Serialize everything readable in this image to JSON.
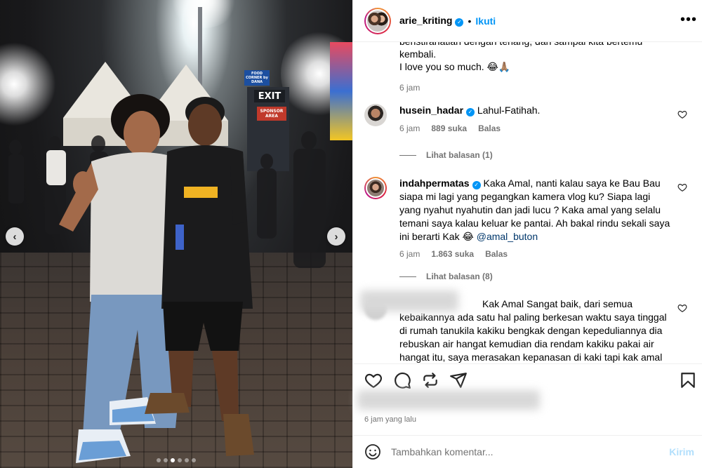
{
  "photo": {
    "signs": {
      "exit": "EXIT",
      "food_corner": "FOOD CORNER by DANA",
      "sponsor": "SPONSOR AREA"
    },
    "carousel": {
      "total_slides": 6,
      "active_index": 2
    }
  },
  "header": {
    "username": "arie_kriting",
    "follow_label": "Ikuti",
    "more_label": "•••",
    "separator": "•"
  },
  "caption": {
    "lines": [
      "beristirahatlah dengan tenang, dan sampai kita bertemu",
      "kembali.",
      "I love you so much. 😂🙏🏽"
    ],
    "time": "6 jam"
  },
  "comments": [
    {
      "username": "husein_hadar",
      "text": "Lahul-Fatihah.",
      "time": "6 jam",
      "likes": "889 suka",
      "reply_label": "Balas",
      "view_replies": "Lihat balasan (1)"
    },
    {
      "username": "indahpermatas",
      "text": "Kaka Amal, nanti kalau saya ke Bau Bau siapa mi lagi yang pegangkan kamera vlog ku? Siapa lagi yang nyahut nyahutin dan jadi lucu ? Kaka amal yang selalu temani saya kalau keluar ke pantai. Ah bakal rindu sekali saya ini berarti Kak 😂",
      "mention": "@amal_buton",
      "time": "6 jam",
      "likes": "1.863 suka",
      "reply_label": "Balas",
      "view_replies": "Lihat balasan (8)"
    },
    {
      "username": "",
      "text": "Kak Amal Sangat baik, dari semua kebaikannya ada satu hal paling berkesan waktu saya tinggal di rumah tanukila kakiku bengkak dengan kepeduliannya dia rebuskan air hangat kemudian dia rendam kakiku pakai air hangat itu, saya merasakan kepanasan di kaki tapi kak amal"
    }
  ],
  "footer": {
    "time_ago": "6 jam yang lalu",
    "comment_placeholder": "Tambahkan komentar...",
    "post_label": "Kirim"
  },
  "colors": {
    "accent": "#0095f6",
    "muted": "#737373",
    "border": "#efefef",
    "post_disabled": "#b2dffc"
  }
}
